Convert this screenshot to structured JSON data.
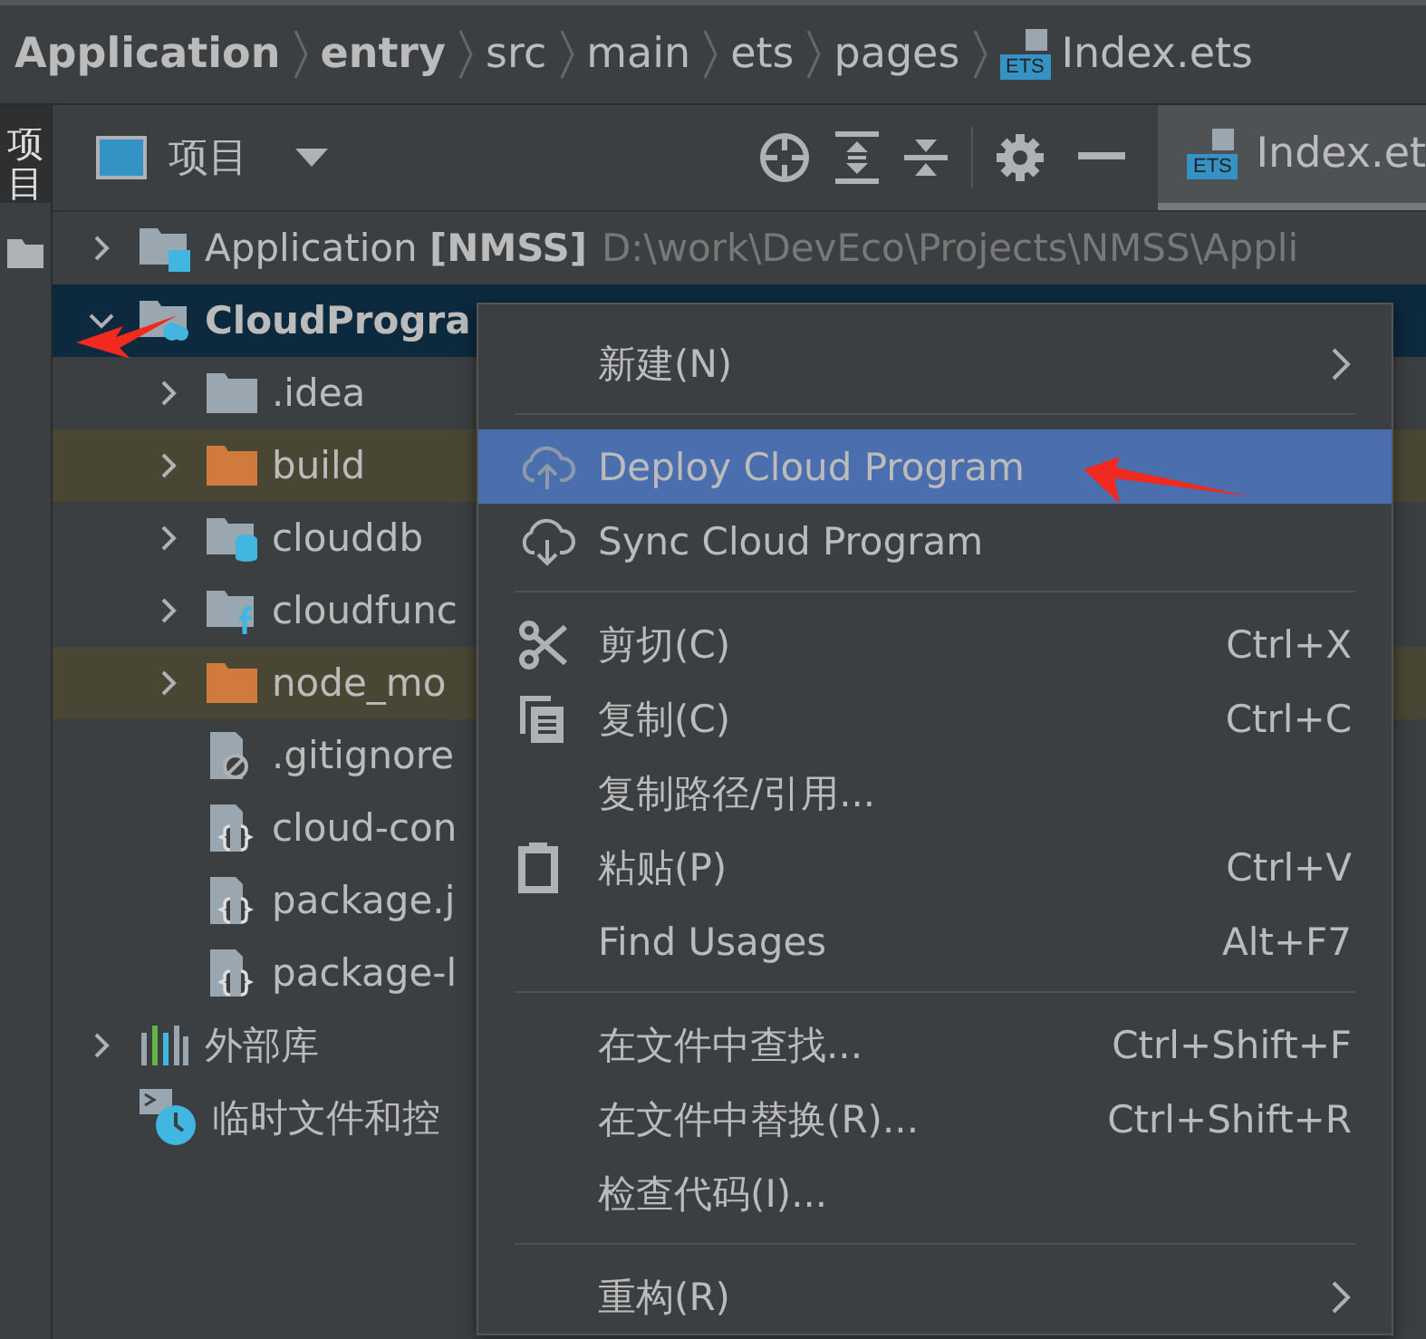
{
  "breadcrumb": [
    {
      "label": "Application",
      "bold": true
    },
    {
      "label": "entry",
      "bold": true
    },
    {
      "label": "src",
      "bold": false
    },
    {
      "label": "main",
      "bold": false
    },
    {
      "label": "ets",
      "bold": false
    },
    {
      "label": "pages",
      "bold": false
    },
    {
      "label": "Index.ets",
      "bold": false,
      "badge": "ETS"
    }
  ],
  "side_tab": {
    "label": "项目",
    "selected": true
  },
  "panel": {
    "view_label": "项目",
    "editor_tab": {
      "label": "Index.et",
      "badge": "ETS",
      "selected": true
    }
  },
  "tree": [
    {
      "kind": "module",
      "label": "Application **[NMSS]**",
      "path": "D:\\work\\DevEco\\Projects\\NMSS\\Appli",
      "expanded": false,
      "selected": false
    },
    {
      "kind": "cloud-module",
      "label": "CloudProgra",
      "expanded": true,
      "selected": true,
      "children": [
        {
          "kind": "folder",
          "label": ".idea",
          "expanded": false,
          "selected": false
        },
        {
          "kind": "excluded-folder",
          "label": "build",
          "expanded": false,
          "selected": false
        },
        {
          "kind": "db-folder",
          "label": "clouddb",
          "expanded": false,
          "selected": false
        },
        {
          "kind": "function-folder",
          "label": "cloudfunc",
          "expanded": false,
          "selected": false
        },
        {
          "kind": "excluded-folder",
          "label": "node_mo",
          "expanded": false,
          "selected": false
        },
        {
          "kind": "ignore-file",
          "label": ".gitignore",
          "selected": false
        },
        {
          "kind": "json-file",
          "label": "cloud-con",
          "selected": false
        },
        {
          "kind": "json-file",
          "label": "package.j",
          "selected": false
        },
        {
          "kind": "json-file",
          "label": "package-l",
          "selected": false
        }
      ]
    },
    {
      "kind": "libraries",
      "label": "外部库",
      "expanded": false,
      "selected": false
    },
    {
      "kind": "scratches",
      "label": "临时文件和控",
      "selected": false
    }
  ],
  "context_menu": {
    "items": [
      {
        "kind": "plain",
        "label": "新建(N)",
        "submenu": true,
        "selected": false
      },
      {
        "kind": "separator"
      },
      {
        "kind": "upload",
        "label": "Deploy Cloud Program",
        "selected": true
      },
      {
        "kind": "download",
        "label": "Sync Cloud Program",
        "selected": false
      },
      {
        "kind": "separator"
      },
      {
        "kind": "cut",
        "label": "剪切(C)",
        "shortcut": "Ctrl+X",
        "selected": false
      },
      {
        "kind": "copy",
        "label": "复制(C)",
        "shortcut": "Ctrl+C",
        "selected": false
      },
      {
        "kind": "plain",
        "label": "复制路径/引用...",
        "selected": false
      },
      {
        "kind": "paste",
        "label": "粘贴(P)",
        "shortcut": "Ctrl+V",
        "selected": false
      },
      {
        "kind": "plain",
        "label": "Find Usages",
        "shortcut": "Alt+F7",
        "selected": false
      },
      {
        "kind": "separator"
      },
      {
        "kind": "plain",
        "label": "在文件中查找...",
        "shortcut": "Ctrl+Shift+F",
        "selected": false
      },
      {
        "kind": "plain",
        "label": "在文件中替换(R)...",
        "shortcut": "Ctrl+Shift+R",
        "selected": false
      },
      {
        "kind": "plain",
        "label": "检查代码(I)...",
        "selected": false
      },
      {
        "kind": "separator"
      },
      {
        "kind": "plain",
        "label": "重构(R)",
        "submenu": true,
        "selected": false
      }
    ]
  }
}
